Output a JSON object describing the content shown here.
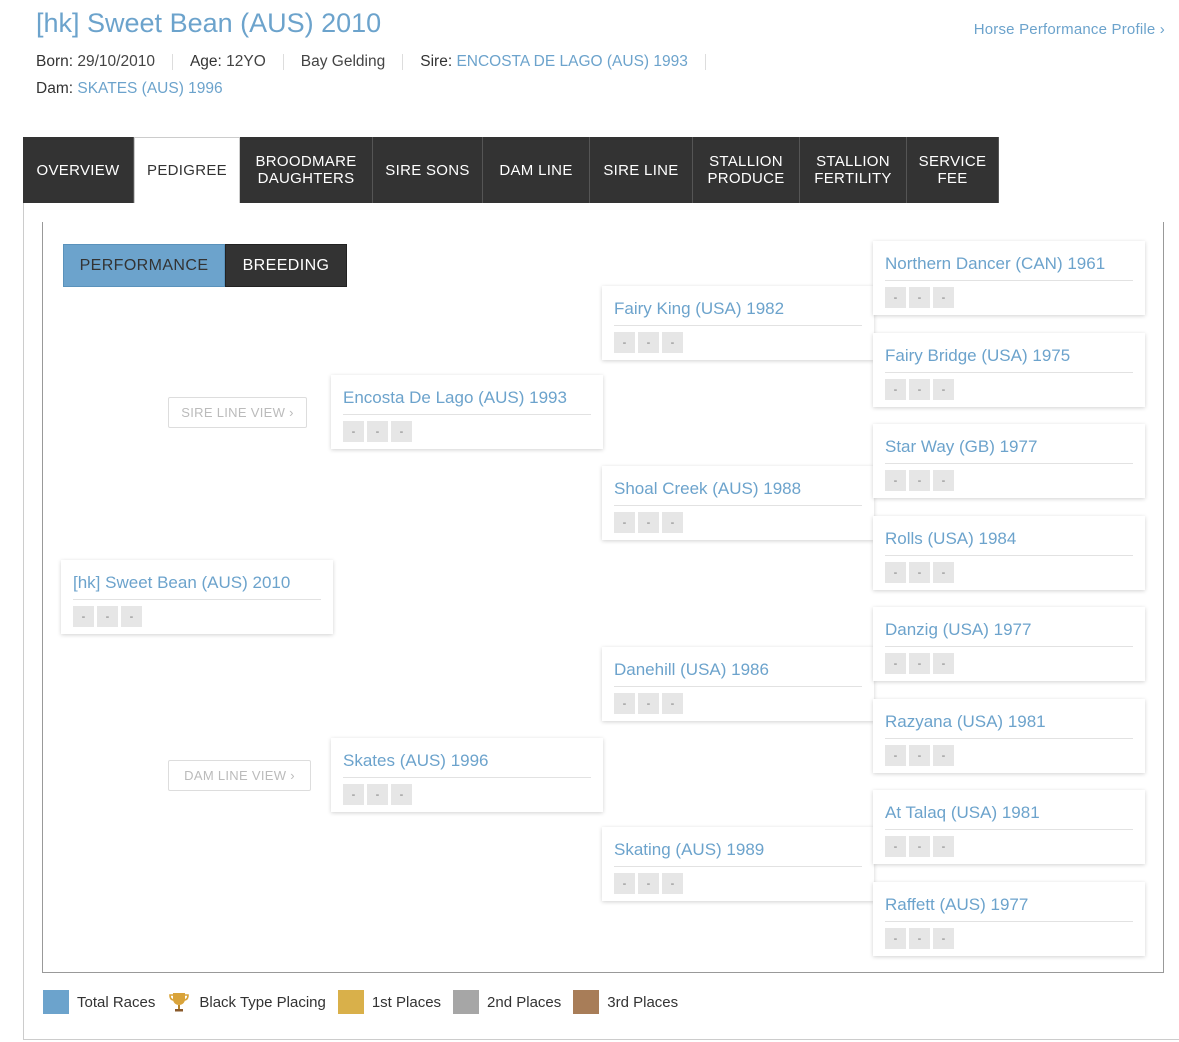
{
  "header": {
    "title": "[hk] Sweet Bean (AUS) 2010",
    "profile_link": "Horse Performance Profile ›",
    "born_label": "Born:",
    "born_value": "29/10/2010",
    "age_label": "Age:",
    "age_value": "12YO",
    "color_sex": "Bay Gelding",
    "sire_label": "Sire:",
    "sire_value": "ENCOSTA DE LAGO (AUS) 1993",
    "dam_label": "Dam:",
    "dam_value": "SKATES (AUS) 1996"
  },
  "tabs": [
    {
      "label": "OVERVIEW"
    },
    {
      "label": "PEDIGREE",
      "active": true
    },
    {
      "label": "BROODMARE DAUGHTERS"
    },
    {
      "label": "SIRE SONS"
    },
    {
      "label": "DAM LINE"
    },
    {
      "label": "SIRE LINE"
    },
    {
      "label": "STALLION PRODUCE"
    },
    {
      "label": "STALLION FERTILITY"
    },
    {
      "label": "SERVICE FEE"
    }
  ],
  "toggle": {
    "performance": "PERFORMANCE",
    "breeding": "BREEDING"
  },
  "sire_line_view": "SIRE LINE VIEW ›",
  "dam_line_view": "DAM LINE VIEW ›",
  "pedigree": {
    "subject": {
      "name": "[hk] Sweet Bean (AUS) 2010",
      "stats": [
        "-",
        "-",
        "-"
      ]
    },
    "gen1": [
      {
        "name": "Encosta De Lago (AUS) 1993",
        "stats": [
          "-",
          "-",
          "-"
        ]
      },
      {
        "name": "Skates (AUS) 1996",
        "stats": [
          "-",
          "-",
          "-"
        ]
      }
    ],
    "gen2": [
      {
        "name": "Fairy King (USA) 1982",
        "stats": [
          "-",
          "-",
          "-"
        ]
      },
      {
        "name": "Shoal Creek (AUS) 1988",
        "stats": [
          "-",
          "-",
          "-"
        ]
      },
      {
        "name": "Danehill (USA) 1986",
        "stats": [
          "-",
          "-",
          "-"
        ]
      },
      {
        "name": "Skating (AUS) 1989",
        "stats": [
          "-",
          "-",
          "-"
        ]
      }
    ],
    "gen3": [
      {
        "name": "Northern Dancer (CAN) 1961",
        "stats": [
          "-",
          "-",
          "-"
        ]
      },
      {
        "name": "Fairy Bridge (USA) 1975",
        "stats": [
          "-",
          "-",
          "-"
        ]
      },
      {
        "name": "Star Way (GB) 1977",
        "stats": [
          "-",
          "-",
          "-"
        ]
      },
      {
        "name": "Rolls (USA) 1984",
        "stats": [
          "-",
          "-",
          "-"
        ]
      },
      {
        "name": "Danzig (USA) 1977",
        "stats": [
          "-",
          "-",
          "-"
        ]
      },
      {
        "name": "Razyana (USA) 1981",
        "stats": [
          "-",
          "-",
          "-"
        ]
      },
      {
        "name": "At Talaq (USA) 1981",
        "stats": [
          "-",
          "-",
          "-"
        ]
      },
      {
        "name": "Raffett (AUS) 1977",
        "stats": [
          "-",
          "-",
          "-"
        ]
      }
    ]
  },
  "legend": [
    {
      "label": "Total Races",
      "color": "#6ca3cc"
    },
    {
      "label": "Black Type Placing",
      "icon": "trophy-icon"
    },
    {
      "label": "1st Places",
      "color": "#d9b04a"
    },
    {
      "label": "2nd Places",
      "color": "#a6a6a6"
    },
    {
      "label": "3rd Places",
      "color": "#a87d58"
    }
  ],
  "colors": {
    "accent": "#6ca3cc",
    "tab_dark": "#333333"
  }
}
